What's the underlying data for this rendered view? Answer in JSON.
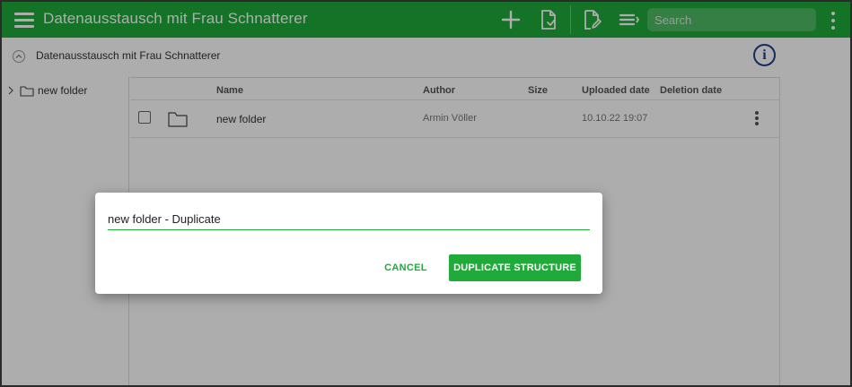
{
  "header": {
    "title": "Datenausstausch mit Frau Schnatterer",
    "search_placeholder": "Search"
  },
  "breadcrumb": {
    "label": "Datenausstausch mit Frau Schnatterer"
  },
  "info_icon": "i",
  "sidebar": {
    "items": [
      {
        "label": "new folder",
        "icon": "folder-icon"
      }
    ]
  },
  "table": {
    "columns": [
      "Name",
      "Author",
      "Size",
      "Uploaded date",
      "Deletion date"
    ],
    "rows": [
      {
        "name": "new folder",
        "author": "Armin Völler",
        "size": "",
        "uploaded": "10.10.22 19:07",
        "deletion": ""
      }
    ]
  },
  "dialog": {
    "input_value": "new folder - Duplicate",
    "cancel_label": "CANCEL",
    "confirm_label": "DUPLICATE STRUCTURE"
  },
  "colors": {
    "brand_green": "#1faa3a",
    "info_blue": "#1f3f8f"
  }
}
